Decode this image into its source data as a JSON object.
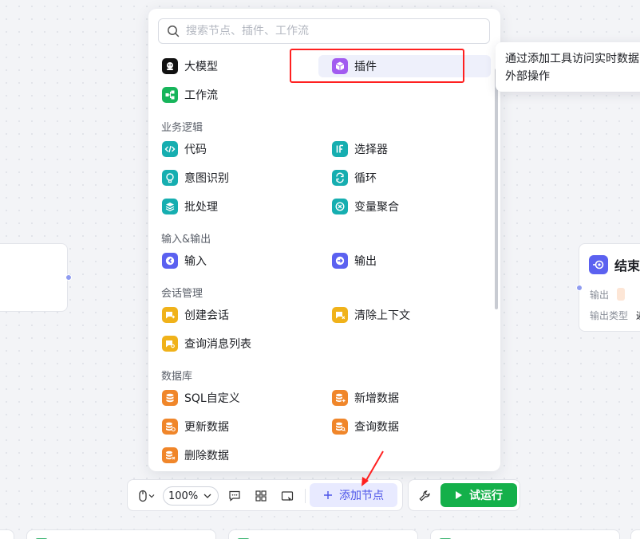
{
  "search": {
    "placeholder": "搜索节点、插件、工作流"
  },
  "top_items": [
    {
      "label": "大模型",
      "icon": "llm-icon"
    },
    {
      "label": "插件",
      "icon": "plugin-icon"
    },
    {
      "label": "工作流",
      "icon": "workflow-icon"
    }
  ],
  "sections": [
    {
      "title": "业务逻辑",
      "items": [
        {
          "label": "代码",
          "icon": "code-icon"
        },
        {
          "label": "选择器",
          "icon": "if-icon"
        },
        {
          "label": "意图识别",
          "icon": "intent-icon"
        },
        {
          "label": "循环",
          "icon": "loop-icon"
        },
        {
          "label": "批处理",
          "icon": "batch-icon"
        },
        {
          "label": "变量聚合",
          "icon": "variable-aggregate-icon"
        }
      ]
    },
    {
      "title": "输入&输出",
      "items": [
        {
          "label": "输入",
          "icon": "input-icon"
        },
        {
          "label": "输出",
          "icon": "output-icon"
        }
      ]
    },
    {
      "title": "会话管理",
      "items": [
        {
          "label": "创建会话",
          "icon": "create-conversation-icon"
        },
        {
          "label": "清除上下文",
          "icon": "clear-context-icon"
        },
        {
          "label": "查询消息列表",
          "icon": "query-messages-icon"
        }
      ]
    },
    {
      "title": "数据库",
      "items": [
        {
          "label": "SQL自定义",
          "icon": "sql-icon"
        },
        {
          "label": "新增数据",
          "icon": "insert-data-icon"
        },
        {
          "label": "更新数据",
          "icon": "update-data-icon"
        },
        {
          "label": "查询数据",
          "icon": "query-data-icon"
        },
        {
          "label": "删除数据",
          "icon": "delete-data-icon"
        }
      ]
    }
  ],
  "tooltip": {
    "line1": "通过添加工具访问实时数据",
    "line2": "外部操作"
  },
  "end_node": {
    "title": "结束",
    "output_label": "输出",
    "output_type_label": "输出类型",
    "output_type_value": "返"
  },
  "toolbar": {
    "zoom": "100%",
    "add_node_label": "添加节点",
    "run_label": "试运行"
  },
  "colors": {
    "accent": "#4c54e8",
    "run_green": "#14b04a",
    "highlight_red": "#ff2020"
  }
}
